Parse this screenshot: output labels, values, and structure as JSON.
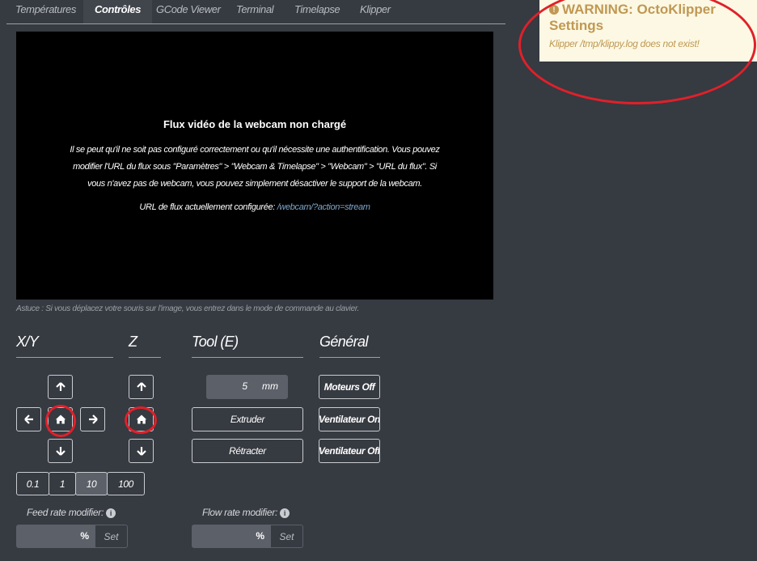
{
  "tabs": [
    {
      "label": "Températures",
      "active": false
    },
    {
      "label": "Contrôles",
      "active": true
    },
    {
      "label": "GCode Viewer",
      "active": false
    },
    {
      "label": "Terminal",
      "active": false
    },
    {
      "label": "Timelapse",
      "active": false
    },
    {
      "label": "Klipper",
      "active": false
    }
  ],
  "webcam": {
    "title": "Flux vidéo de la webcam non chargé",
    "message": "Il se peut qu'il ne soit pas configuré correctement ou qu'il nécessite une authentification. Vous pouvez modifier l'URL du flux sous \"Paramètres\" > \"Webcam & Timelapse\" > \"Webcam\" > \"URL du flux\". Si vous n'avez pas de webcam, vous pouvez simplement désactiver le support de la webcam.",
    "url_label": "URL de flux actuellement configurée:",
    "url_value": "/webcam/?action=stream"
  },
  "hint": "Astuce : Si vous déplacez votre souris sur l'image, vous entrez dans le mode de commande au clavier.",
  "headers": {
    "xy": "X/Y",
    "z": "Z",
    "tool": "Tool (E)",
    "general": "Général"
  },
  "jog": {
    "icons": {
      "up": "arrow-up-icon",
      "down": "arrow-down-icon",
      "left": "arrow-left-icon",
      "right": "arrow-right-icon",
      "home": "home-icon"
    },
    "distances": [
      "0.1",
      "1",
      "10",
      "100"
    ],
    "selected_distance": "10"
  },
  "tool": {
    "amount_value": "5",
    "amount_unit": "mm",
    "extrude_label": "Extruder",
    "retract_label": "Rétracter"
  },
  "general": {
    "motors_off": "Moteurs Off",
    "fan_on": "Ventilateur On",
    "fan_off": "Ventilateur Off"
  },
  "feed_rate": {
    "label": "Feed rate modifier:",
    "unit": "%",
    "set_label": "Set"
  },
  "flow_rate": {
    "label": "Flow rate modifier:",
    "unit": "%",
    "set_label": "Set"
  },
  "warning": {
    "title": "WARNING: OctoKlipper Settings",
    "message": "Klipper /tmp/klippy.log does not exist!",
    "icon": "exclamation-circle-icon"
  },
  "colors": {
    "background": "#363a41",
    "warning_bg": "#fcf8e3",
    "warning_text": "#c09853",
    "annotation_red": "#e0202a"
  }
}
